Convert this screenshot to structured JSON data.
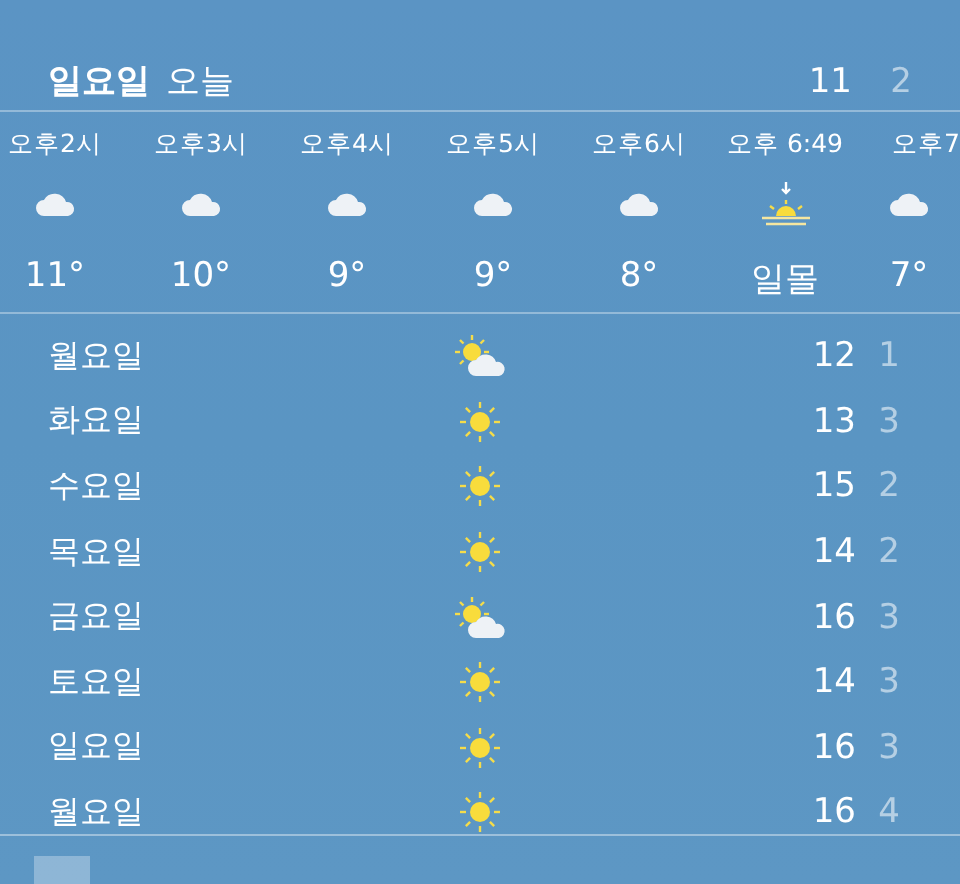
{
  "today": {
    "day": "일요일",
    "label": "오늘",
    "high": "11",
    "low": "2"
  },
  "hourly": [
    {
      "time": "오후2시",
      "kind": "cloud",
      "temp": "11°"
    },
    {
      "time": "오후3시",
      "kind": "cloud",
      "temp": "10°"
    },
    {
      "time": "오후4시",
      "kind": "cloud",
      "temp": "9°"
    },
    {
      "time": "오후5시",
      "kind": "cloud",
      "temp": "9°"
    },
    {
      "time": "오후6시",
      "kind": "cloud",
      "temp": "8°"
    },
    {
      "time": "오후 6:49",
      "kind": "sunset",
      "temp": "일몰"
    },
    {
      "time": "오후7",
      "kind": "cloud",
      "temp": "7°"
    }
  ],
  "daily": [
    {
      "day": "월요일",
      "kind": "partly",
      "high": "12",
      "low": "1"
    },
    {
      "day": "화요일",
      "kind": "sun",
      "high": "13",
      "low": "3"
    },
    {
      "day": "수요일",
      "kind": "sun",
      "high": "15",
      "low": "2"
    },
    {
      "day": "목요일",
      "kind": "sun",
      "high": "14",
      "low": "2"
    },
    {
      "day": "금요일",
      "kind": "partly",
      "high": "16",
      "low": "3"
    },
    {
      "day": "토요일",
      "kind": "sun",
      "high": "14",
      "low": "3"
    },
    {
      "day": "일요일",
      "kind": "sun",
      "high": "16",
      "low": "3"
    },
    {
      "day": "월요일",
      "kind": "sun",
      "high": "16",
      "low": "4"
    }
  ]
}
